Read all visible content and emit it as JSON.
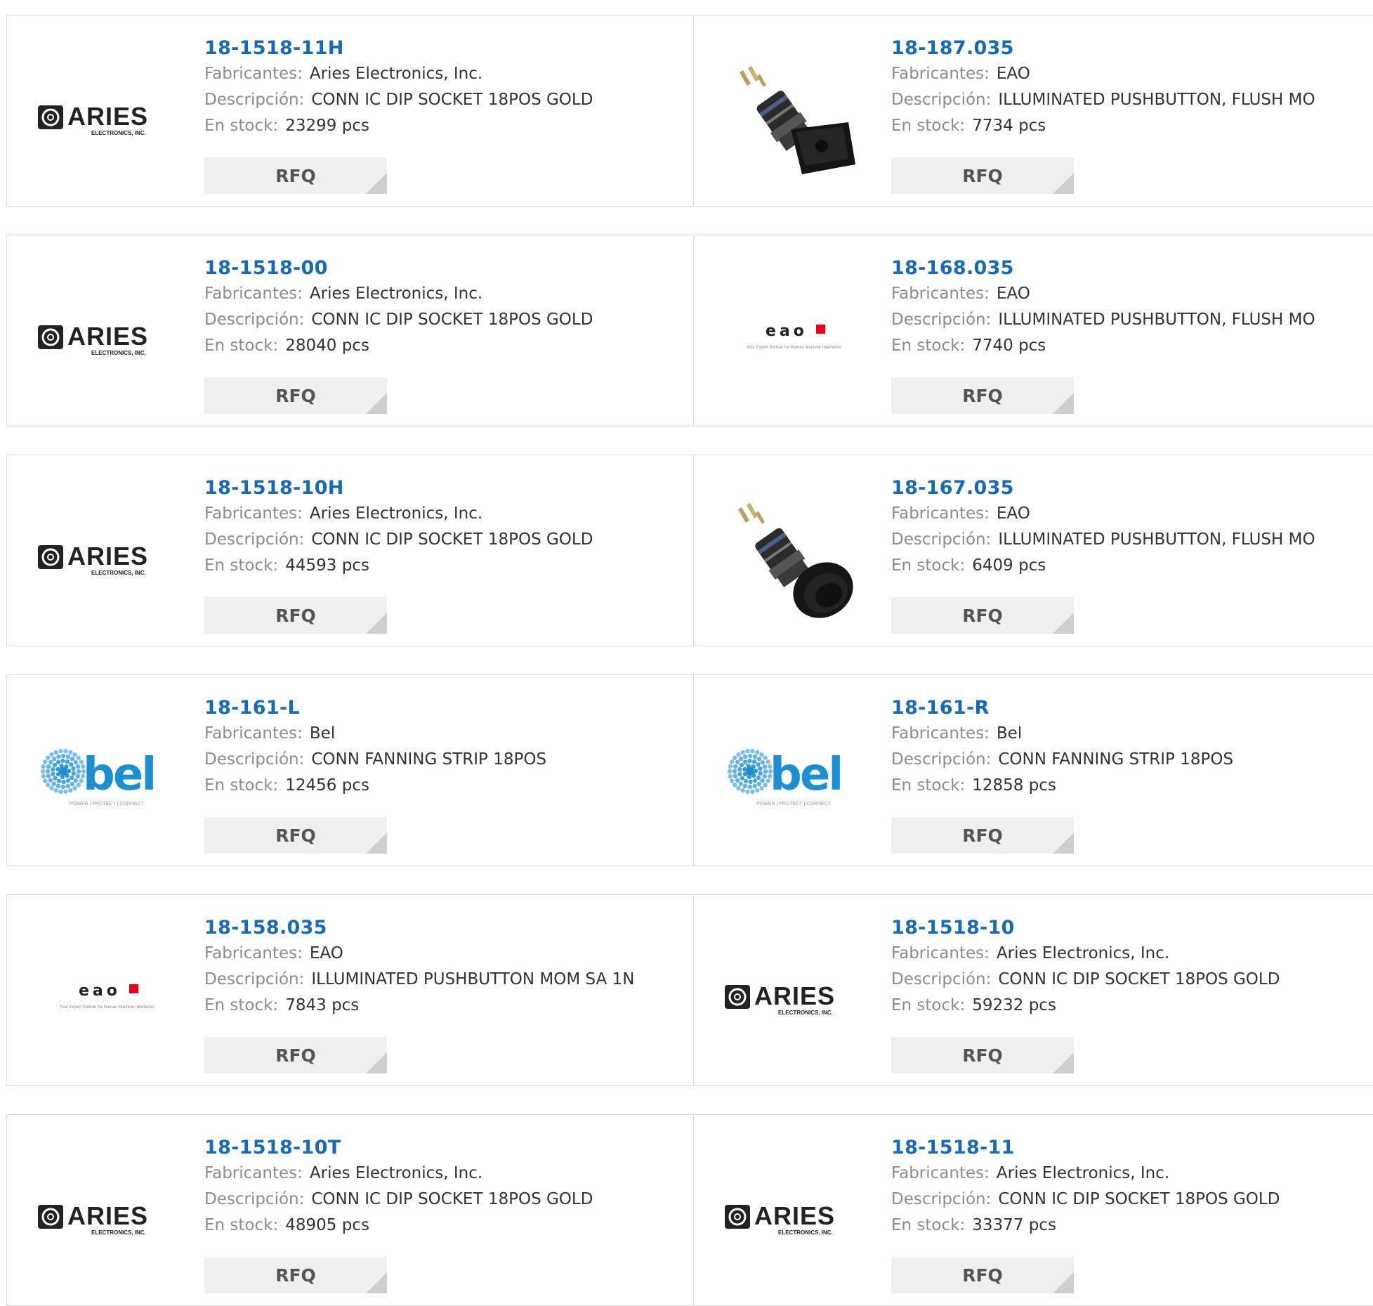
{
  "labels": {
    "manufacturer": "Fabricantes:",
    "description": "Descripción:",
    "stock": "En stock:",
    "rfq": "RFQ"
  },
  "logo_text": {
    "aries": "ARIES",
    "aries_sub": "ELECTRONICS, INC.",
    "eao": "eao",
    "eao_sub": "Your Expert Partner for Human Machine Interfaces",
    "bel": "bel",
    "bel_sub": "POWER | PROTECT | CONNECT"
  },
  "products": [
    {
      "part": "18-1518-11H",
      "manufacturer": "Aries Electronics, Inc.",
      "description": "CONN IC DIP SOCKET 18POS GOLD",
      "stock": "23299 pcs",
      "image": "aries-logo"
    },
    {
      "part": "18-187.035",
      "manufacturer": "EAO",
      "description": "ILLUMINATED PUSHBUTTON, FLUSH MO",
      "stock": "7734 pcs",
      "image": "square-pushbutton-photo"
    },
    {
      "part": "18-1518-00",
      "manufacturer": "Aries Electronics, Inc.",
      "description": "CONN IC DIP SOCKET 18POS GOLD",
      "stock": "28040 pcs",
      "image": "aries-logo"
    },
    {
      "part": "18-168.035",
      "manufacturer": "EAO",
      "description": "ILLUMINATED PUSHBUTTON, FLUSH MO",
      "stock": "7740 pcs",
      "image": "eao-logo"
    },
    {
      "part": "18-1518-10H",
      "manufacturer": "Aries Electronics, Inc.",
      "description": "CONN IC DIP SOCKET 18POS GOLD",
      "stock": "44593 pcs",
      "image": "aries-logo"
    },
    {
      "part": "18-167.035",
      "manufacturer": "EAO",
      "description": "ILLUMINATED PUSHBUTTON, FLUSH MO",
      "stock": "6409 pcs",
      "image": "round-pushbutton-photo"
    },
    {
      "part": "18-161-L",
      "manufacturer": "Bel",
      "description": "CONN FANNING STRIP 18POS",
      "stock": "12456 pcs",
      "image": "bel-logo"
    },
    {
      "part": "18-161-R",
      "manufacturer": "Bel",
      "description": "CONN FANNING STRIP 18POS",
      "stock": "12858 pcs",
      "image": "bel-logo"
    },
    {
      "part": "18-158.035",
      "manufacturer": "EAO",
      "description": "ILLUMINATED PUSHBUTTON MOM SA 1N",
      "stock": "7843 pcs",
      "image": "eao-logo"
    },
    {
      "part": "18-1518-10",
      "manufacturer": "Aries Electronics, Inc.",
      "description": "CONN IC DIP SOCKET 18POS GOLD",
      "stock": "59232 pcs",
      "image": "aries-logo"
    },
    {
      "part": "18-1518-10T",
      "manufacturer": "Aries Electronics, Inc.",
      "description": "CONN IC DIP SOCKET 18POS GOLD",
      "stock": "48905 pcs",
      "image": "aries-logo"
    },
    {
      "part": "18-1518-11",
      "manufacturer": "Aries Electronics, Inc.",
      "description": "CONN IC DIP SOCKET 18POS GOLD",
      "stock": "33377 pcs",
      "image": "aries-logo"
    }
  ],
  "colors": {
    "part_link": "#1a69b3",
    "label": "#8c8c8c",
    "value": "#333333",
    "rfq_bg": "#f0f0f0",
    "border": "#d9d9d9",
    "eao_red": "#e2001a",
    "bel_blue": "#1d8fd0"
  }
}
